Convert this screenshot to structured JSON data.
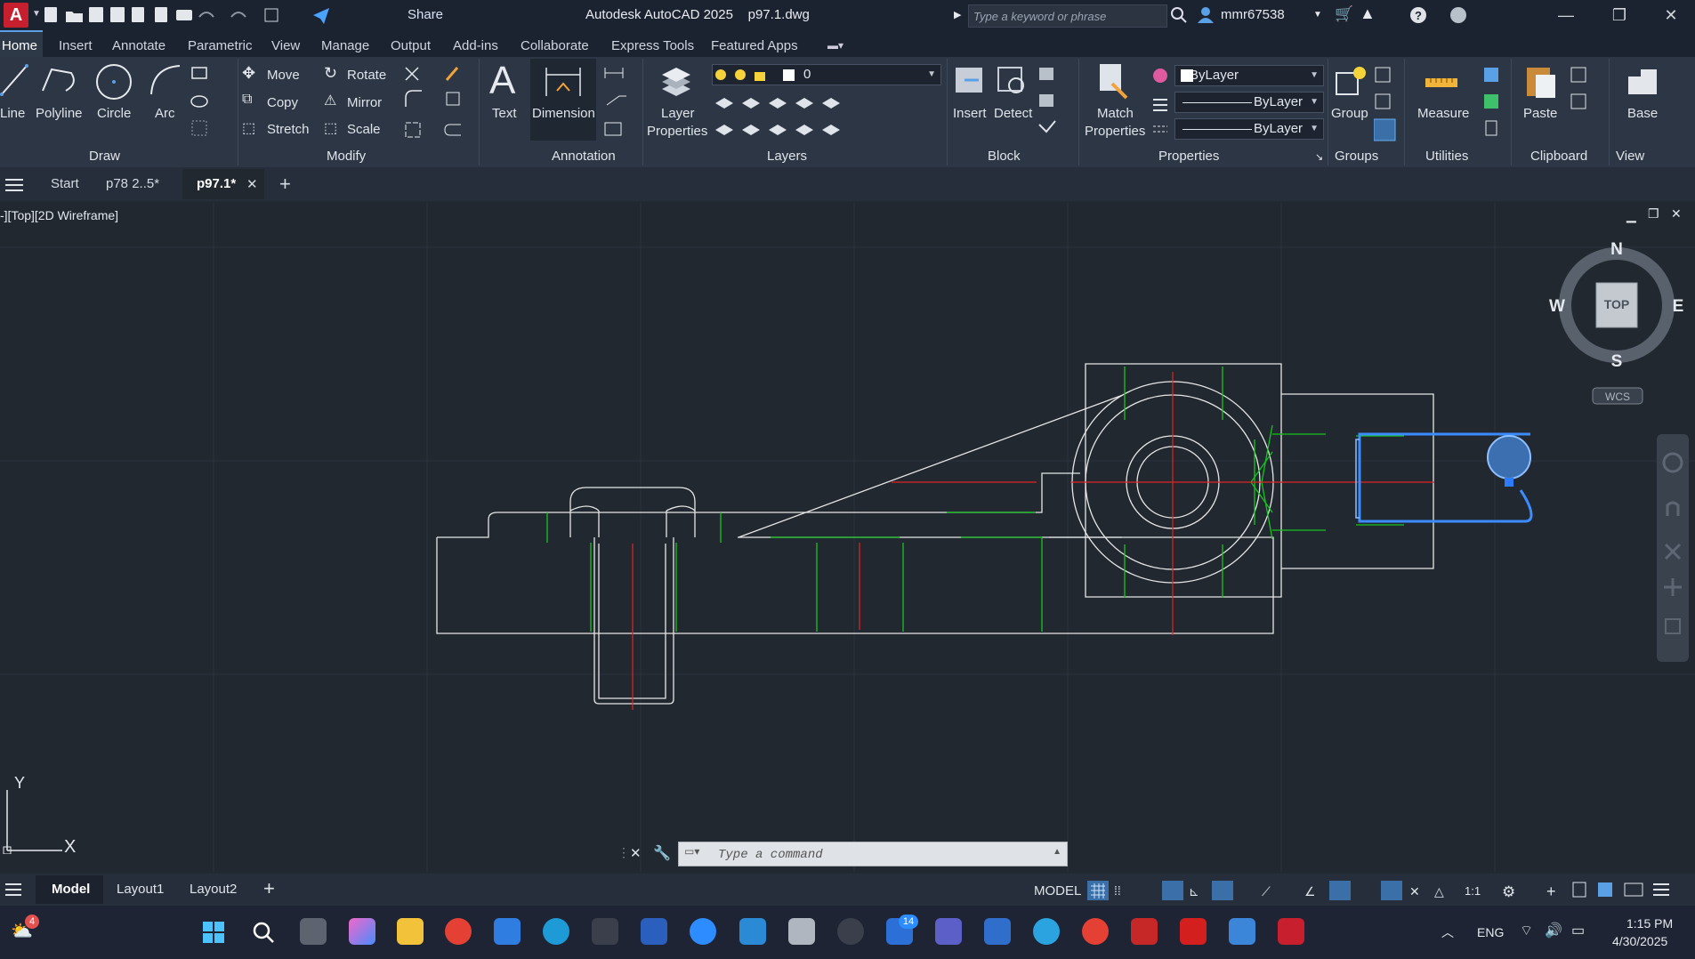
{
  "title_bar": {
    "app_title": "Autodesk AutoCAD 2025",
    "file_name": "p97.1.dwg",
    "share_label": "Share",
    "search_placeholder": "Type a keyword or phrase",
    "user": "mmr67538"
  },
  "menu_tabs": [
    "Home",
    "Insert",
    "Annotate",
    "Parametric",
    "View",
    "Manage",
    "Output",
    "Add-ins",
    "Collaborate",
    "Express Tools",
    "Featured Apps"
  ],
  "ribbon": {
    "draw": {
      "title": "Draw",
      "line": "Line",
      "polyline": "Polyline",
      "circle": "Circle",
      "arc": "Arc"
    },
    "modify": {
      "title": "Modify",
      "move": "Move",
      "rotate": "Rotate",
      "copy": "Copy",
      "mirror": "Mirror",
      "stretch": "Stretch",
      "scale": "Scale"
    },
    "annotation": {
      "title": "Annotation",
      "text": "Text",
      "dimension": "Dimension"
    },
    "layers": {
      "title": "Layers",
      "layer_properties_1": "Layer",
      "layer_properties_2": "Properties",
      "current_layer": "0"
    },
    "block": {
      "title": "Block",
      "insert": "Insert",
      "detect": "Detect"
    },
    "properties": {
      "title": "Properties",
      "match_1": "Match",
      "match_2": "Properties",
      "color": "ByLayer",
      "linetype": "ByLayer",
      "lineweight": "ByLayer"
    },
    "groups": {
      "title": "Groups",
      "group": "Group"
    },
    "utilities": {
      "title": "Utilities",
      "measure": "Measure"
    },
    "clipboard": {
      "title": "Clipboard",
      "paste": "Paste"
    },
    "view": {
      "title": "View",
      "base": "Base"
    }
  },
  "file_tabs": [
    "Start",
    "p78 2..5*",
    "p97.1*"
  ],
  "viewport": {
    "label": "-][Top][2D Wireframe]",
    "viewcube": {
      "n": "N",
      "s": "S",
      "e": "E",
      "w": "W",
      "top": "TOP",
      "wcs": "WCS"
    },
    "ucs": {
      "x": "X",
      "y": "Y"
    }
  },
  "command_line": {
    "placeholder": "Type a command"
  },
  "layout_tabs": [
    "Model",
    "Layout1",
    "Layout2"
  ],
  "status_bar": {
    "space": "MODEL",
    "scale": "1:1"
  },
  "taskbar": {
    "notification_badge": "4",
    "zoom_badge": "14",
    "language": "ENG",
    "time": "1:15 PM",
    "date": "4/30/2025"
  },
  "colors": {
    "centerline": "#e02424",
    "hidden": "#16c51f",
    "geometry": "#e6e6e6",
    "selection": "#3c8cff",
    "accent": "#5aa0e6"
  }
}
